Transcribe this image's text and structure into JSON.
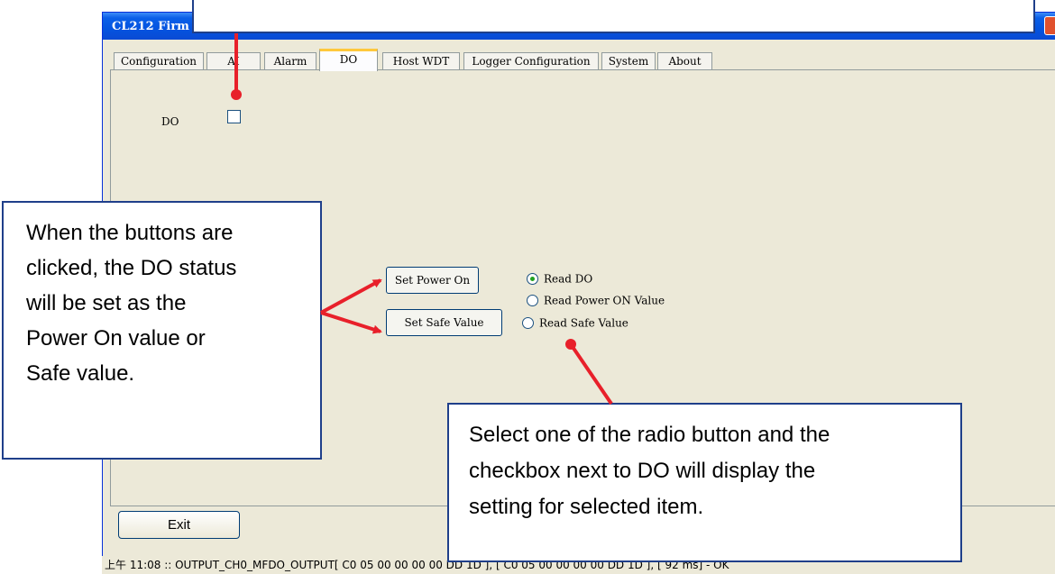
{
  "window": {
    "title": "CL212 Firm",
    "close_label": "×"
  },
  "tabs": [
    {
      "label": "Configuration",
      "active": false
    },
    {
      "label": "AI",
      "active": false
    },
    {
      "label": "Alarm",
      "active": false
    },
    {
      "label": "DO",
      "active": true
    },
    {
      "label": "Host WDT",
      "active": false
    },
    {
      "label": "Logger Configuration",
      "active": false
    },
    {
      "label": "System",
      "active": false
    },
    {
      "label": "About",
      "active": false
    }
  ],
  "do_panel": {
    "do_label": "DO",
    "do_checked": false,
    "set_power_on_label": "Set Power On",
    "set_safe_value_label": "Set Safe Value",
    "radios": [
      {
        "label": "Read DO",
        "selected": true
      },
      {
        "label": "Read Power ON Value",
        "selected": false
      },
      {
        "label": "Read Safe Value",
        "selected": false
      }
    ]
  },
  "exit_label": "Exit",
  "status_bar": "上午 11:08 :: OUTPUT_CH0_MFDO_OUTPUT[ C0 05 00 00 00 00 DD 1D ], [ C0 05 00 00 00 00 DD 1D ], [ 92 ms] - OK",
  "callouts": {
    "left_lines": [
      "When the buttons are",
      "clicked, the DO status",
      "will be set as the",
      "Power On value or",
      "Safe value."
    ],
    "right_lines": [
      "Select one of the radio button and the",
      "checkbox next to DO will display the",
      "setting for selected item."
    ]
  },
  "colors": {
    "annotation_red": "#e8202a",
    "callout_border": "#1f3f8a",
    "xp_title_blue": "#0454e0"
  }
}
